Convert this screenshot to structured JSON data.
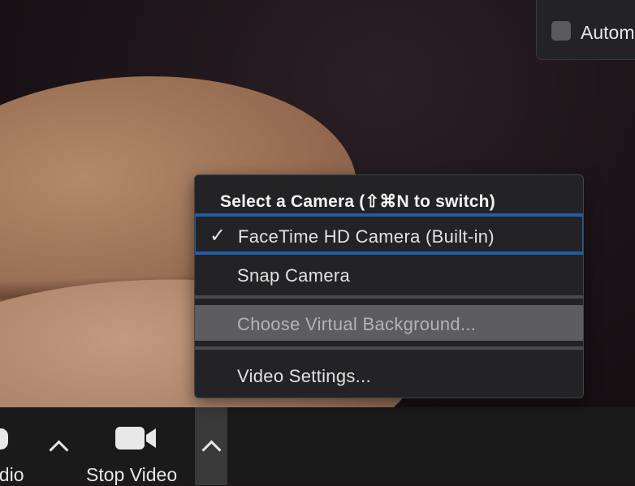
{
  "top_panel": {
    "checkbox_label": "Autom"
  },
  "camera_menu": {
    "header": "Select a Camera (⇧⌘N to switch)",
    "items": [
      {
        "label": "FaceTime HD Camera (Built-in)",
        "checked": true
      },
      {
        "label": "Snap Camera",
        "checked": false
      },
      {
        "label": "Choose Virtual Background...",
        "highlighted": true
      },
      {
        "label": "Video Settings..."
      }
    ],
    "checkmark": "✓"
  },
  "toolbar": {
    "audio_label": "udio",
    "video_label": "Stop Video"
  },
  "colors": {
    "selection": "#1f5fa8",
    "menu_bg": "#232325",
    "highlight_bg": "#5d5d60"
  }
}
